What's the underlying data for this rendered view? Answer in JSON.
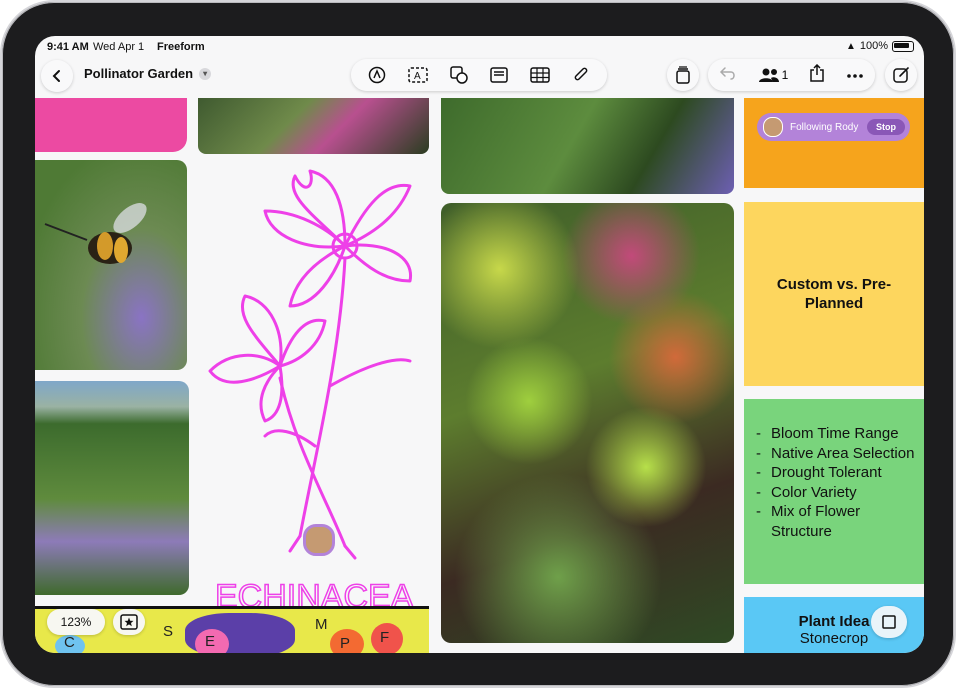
{
  "status": {
    "time": "9:41 AM",
    "date": "Wed Apr 1",
    "app": "Freeform",
    "battery": "100%"
  },
  "board": {
    "title": "Pollinator Garden"
  },
  "toolbar": {
    "tools": [
      "pen-tool",
      "text-box",
      "shapes",
      "sticky-note",
      "table",
      "attachment"
    ],
    "collaborator_count": "1"
  },
  "follow": {
    "label": "Following Rody",
    "stop": "Stop"
  },
  "notes": {
    "yellow": "Custom vs. Pre-Planned",
    "green_items": [
      "Bloom Time Range",
      "Native Area Selection",
      "Drought Tolerant",
      "Color Variety",
      "Mix of Flower Structure"
    ],
    "blue_title": "Plant Idea",
    "blue_sub": "Stonecrop"
  },
  "sketch": {
    "label": "ECHINACEA"
  },
  "strip_letters": [
    "C",
    "S",
    "E",
    "M",
    "P",
    "F"
  ],
  "zoom": "123%",
  "colors": {
    "sketch": "#ee40e8",
    "orange_note": "#f6a41c",
    "yellow_note": "#fdd65e",
    "green_note": "#79d47c",
    "blue_note": "#5ac8f5",
    "follow_pill": "#b383d9"
  }
}
